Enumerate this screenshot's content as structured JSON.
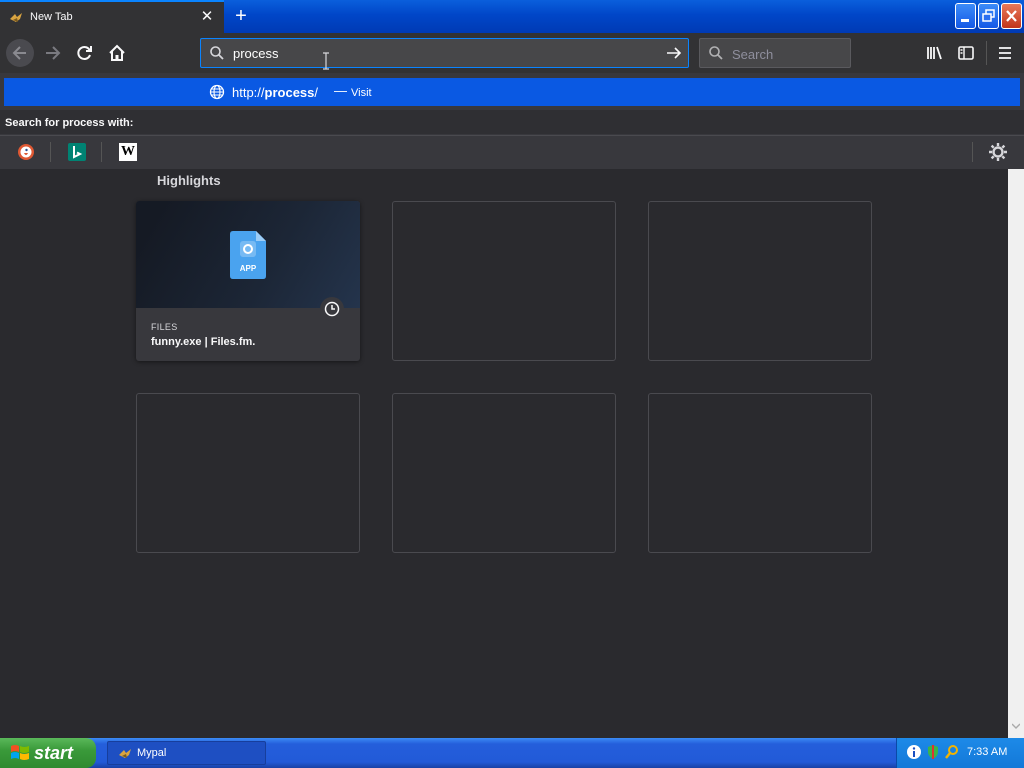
{
  "tab": {
    "title": "New Tab",
    "close": "✕",
    "new_tab": "+"
  },
  "urlbar": {
    "value": "process"
  },
  "searchbar": {
    "placeholder": "Search"
  },
  "suggestion": {
    "scheme": "http://",
    "host": "process",
    "slash": "/",
    "separator": "—",
    "action": "Visit"
  },
  "search_with": {
    "label": "Search for process with:"
  },
  "engines": [
    {
      "name": "duckduckgo-icon"
    },
    {
      "name": "bing-icon"
    },
    {
      "name": "wikipedia-icon",
      "glyph": "W"
    }
  ],
  "highlights": {
    "title": "Highlights",
    "card": {
      "source": "FILES",
      "title": "funny.exe | Files.fm.",
      "icon_label": "APP"
    }
  },
  "taskbar": {
    "start": "start",
    "task": "Mypal",
    "time": "7:33 AM"
  },
  "colors": {
    "accent": "#0a84ff",
    "selection": "#0a59e3",
    "background": "#2a2a2e"
  }
}
